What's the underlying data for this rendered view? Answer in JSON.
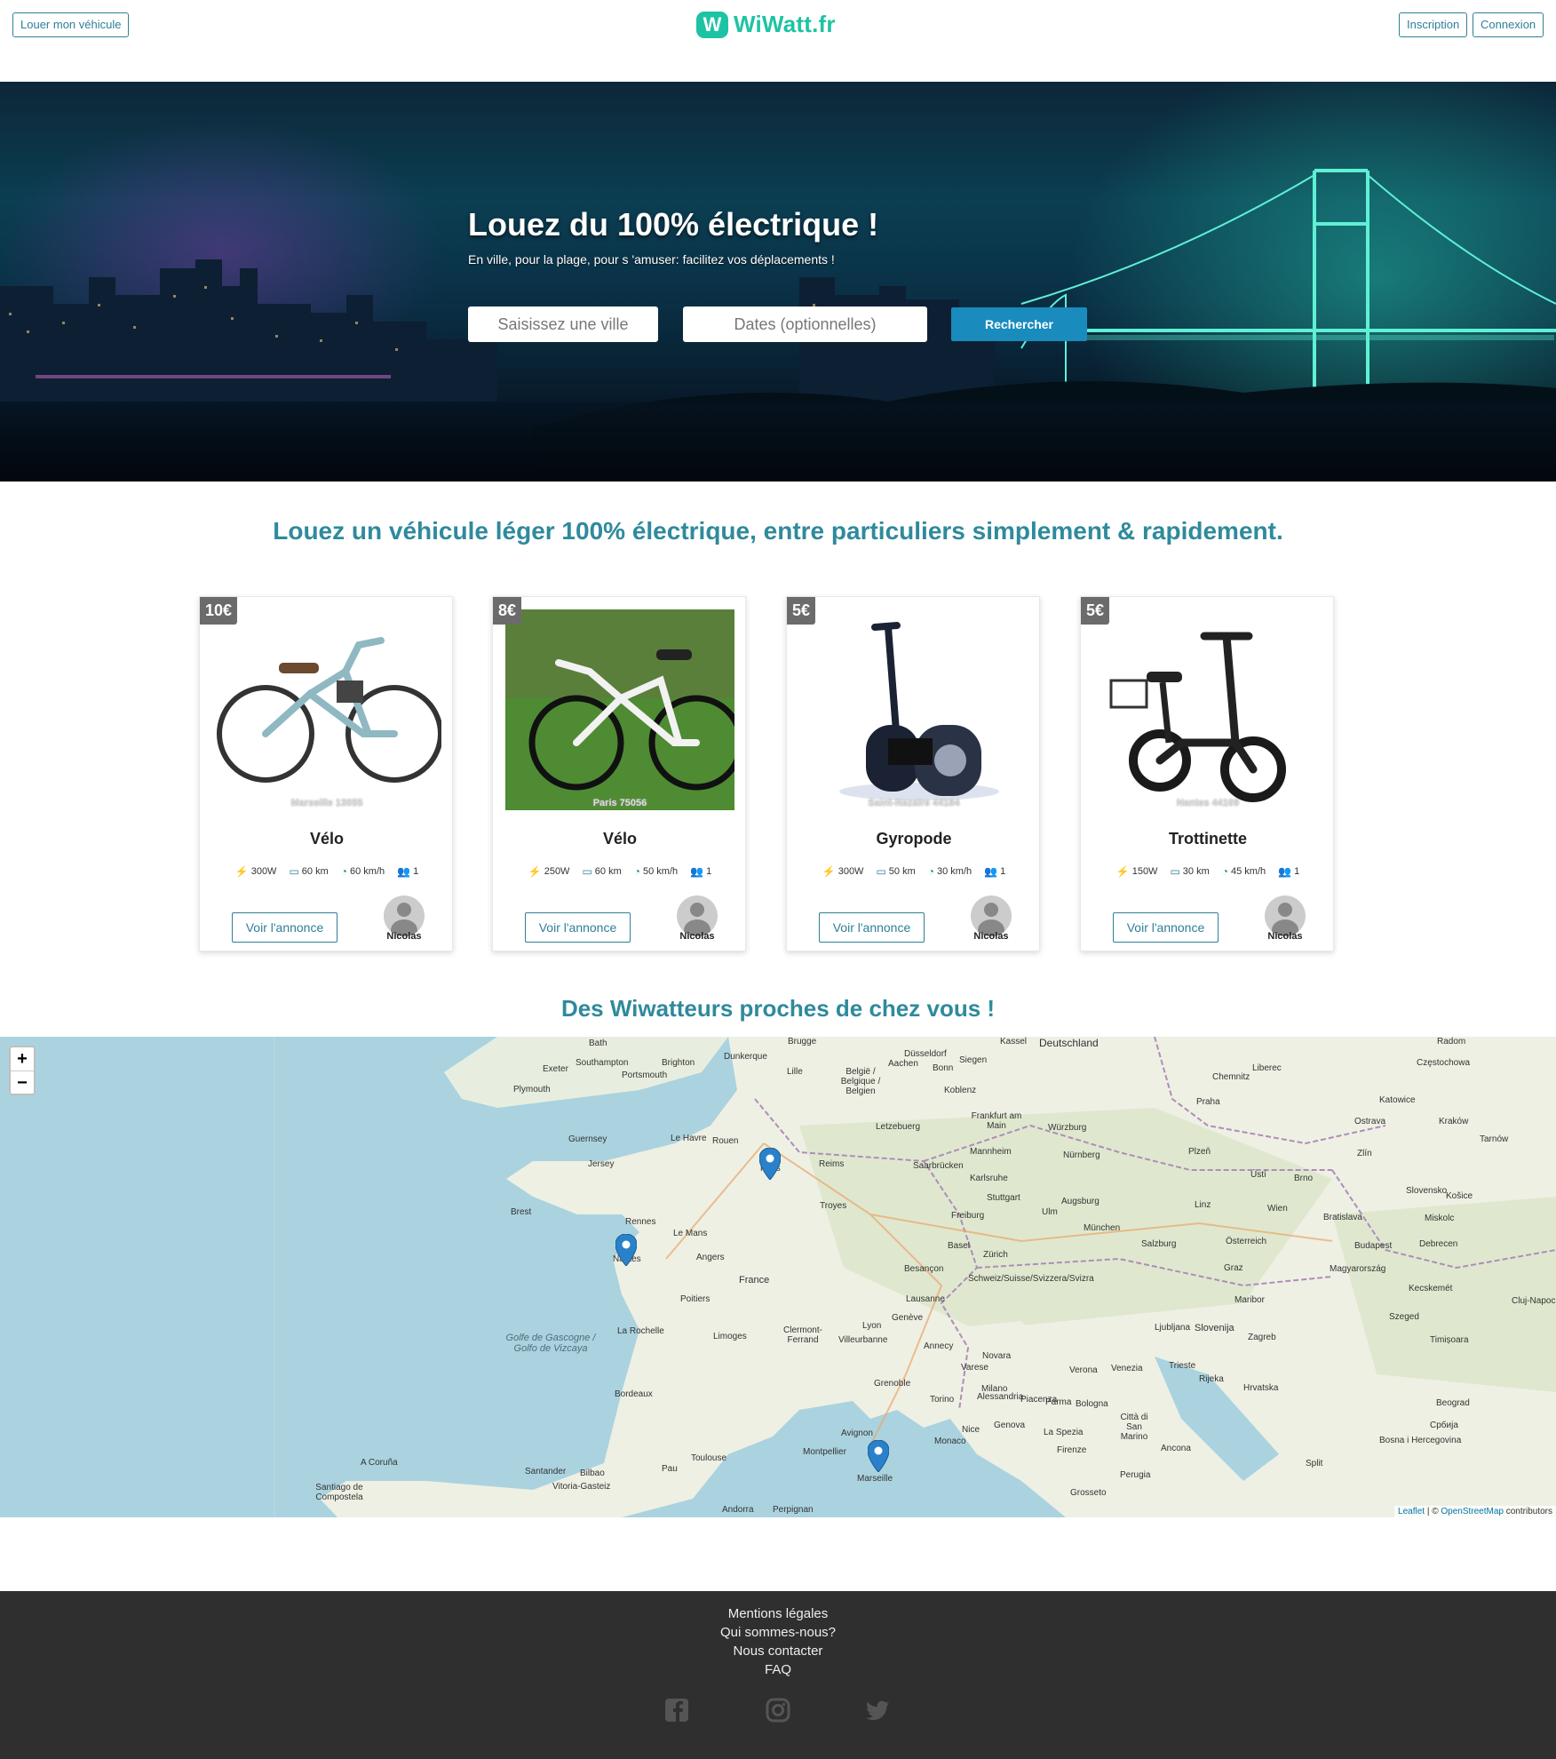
{
  "header": {
    "rent_vehicle": "Louer mon véhicule",
    "logo_text": "WiWatt.fr",
    "signup": "Inscription",
    "login": "Connexion"
  },
  "hero": {
    "title": "Louez du 100% électrique !",
    "subtitle": "En ville, pour la plage, pour s 'amuser: facilitez vos déplacements !",
    "city_placeholder": "Saisissez une ville",
    "dates_placeholder": "Dates (optionnelles)",
    "search_button": "Rechercher"
  },
  "tagline": "Louez un véhicule léger 100% électrique, entre particuliers simplement & rapidement.",
  "listings": [
    {
      "price": "10€",
      "location": "Marseille 13055",
      "title": "Vélo",
      "power": "300W",
      "range": "60 km",
      "speed": "60 km/h",
      "seats": "1",
      "cta": "Voir l'annonce",
      "owner": "Nicolas"
    },
    {
      "price": "8€",
      "location": "Paris 75056",
      "title": "Vélo",
      "power": "250W",
      "range": "60 km",
      "speed": "50 km/h",
      "seats": "1",
      "cta": "Voir l'annonce",
      "owner": "Nicolas"
    },
    {
      "price": "5€",
      "location": "Saint-Nazaire 44184",
      "title": "Gyropode",
      "power": "300W",
      "range": "50 km",
      "speed": "30 km/h",
      "seats": "1",
      "cta": "Voir l'annonce",
      "owner": "Nicolas"
    },
    {
      "price": "5€",
      "location": "Nantes 44109",
      "title": "Trottinette",
      "power": "150W",
      "range": "30 km",
      "speed": "45 km/h",
      "seats": "1",
      "cta": "Voir l'annonce",
      "owner": "Nicolas"
    }
  ],
  "map": {
    "title": "Des Wiwatteurs proches de chez vous !",
    "zoom_in": "+",
    "zoom_out": "−",
    "attribution_leaflet": "Leaflet",
    "attribution_sep": " | © ",
    "attribution_osm": "OpenStreetMap",
    "attribution_tail": " contributors",
    "cities": [
      "Bath",
      "Brugge",
      "Kassel",
      "Deutschland",
      "Radom",
      "Exeter",
      "Brighton",
      "Dunkerque",
      "Düsseldorf",
      "Siegen",
      "Southampton",
      "Portsmouth",
      "Lille",
      "Aachen",
      "Bonn",
      "Plymouth",
      "België / Belgique / Belgien",
      "Koblenz",
      "Chemnitz",
      "Liberec",
      "Częstochowa",
      "Praha",
      "Katowice",
      "Letzebuerg",
      "Frankfurt am Main",
      "Würzburg",
      "Guernsey",
      "Le Havre",
      "Rouen",
      "Jersey",
      "Reims",
      "Mannheim",
      "Nürnberg",
      "Plzeň",
      "Ostrava",
      "Paris",
      "Saarbrücken",
      "Karlsruhe",
      "Stuttgart",
      "Augsburg",
      "Wien",
      "Brest",
      "Rennes",
      "Troyes",
      "Ulm",
      "Linz",
      "Bratislava",
      "Le Mans",
      "Freiburg",
      "München",
      "Basel",
      "Zürich",
      "Salzburg",
      "Österreich",
      "Budapest",
      "Angers",
      "Nantes",
      "France",
      "Besançon",
      "Schweiz/Suisse/Svizzera/Svizra",
      "Magyarország",
      "Debrecen",
      "Poitiers",
      "Lausanne",
      "Genève",
      "Graz",
      "Maribor",
      "Limoges",
      "Clermont-Ferrand",
      "Lyon",
      "Villeurbanne",
      "Annecy",
      "Ljubljana",
      "Slovenija",
      "Zagreb",
      "La Rochelle",
      "Golfe de Gascogne / Golfo de Vizcaya",
      "Bordeaux",
      "Grenoble",
      "Milano",
      "Varese",
      "Novara",
      "Piacenza",
      "Verona",
      "Venezia",
      "Trieste",
      "Torino",
      "Alessandria",
      "Parma",
      "Bologna",
      "Rijeka",
      "Hrvatska",
      "Avignon",
      "Genova",
      "Montpellier",
      "Toulouse",
      "Marseille",
      "Monaco",
      "Nice",
      "La Spezia",
      "Firenze",
      "Città di San Marino",
      "Ancona",
      "Pau",
      "A Coruña",
      "Santander",
      "Bilbao",
      "Vitoria-Gasteiz",
      "Perugia",
      "Santiago de Compostela",
      "Grosseto",
      "Split",
      "Andorra",
      "Perpignan",
      "Bosna i Hercegovina",
      "Beograd",
      "Србија",
      "Cluj-Napoca",
      "Timișoara",
      "Szeged",
      "Kecskemét",
      "Slovensko",
      "Zlín",
      "Ústí",
      "Brno",
      "Košice",
      "Miskolc",
      "Kraków",
      "Tarnów"
    ],
    "markers": [
      "Paris",
      "Saint-Nazaire",
      "Marseille"
    ]
  },
  "footer": {
    "links": [
      "Mentions légales",
      "Qui sommes-nous?",
      "Nous contacter",
      "FAQ"
    ],
    "social": [
      "facebook-icon",
      "instagram-icon",
      "twitter-icon"
    ]
  },
  "colors": {
    "brand": "#1ec3a3",
    "accent": "#2f7f97",
    "tagline": "#2f8a9c",
    "search": "#1a8bbd",
    "footer": "#2f2f2f"
  }
}
